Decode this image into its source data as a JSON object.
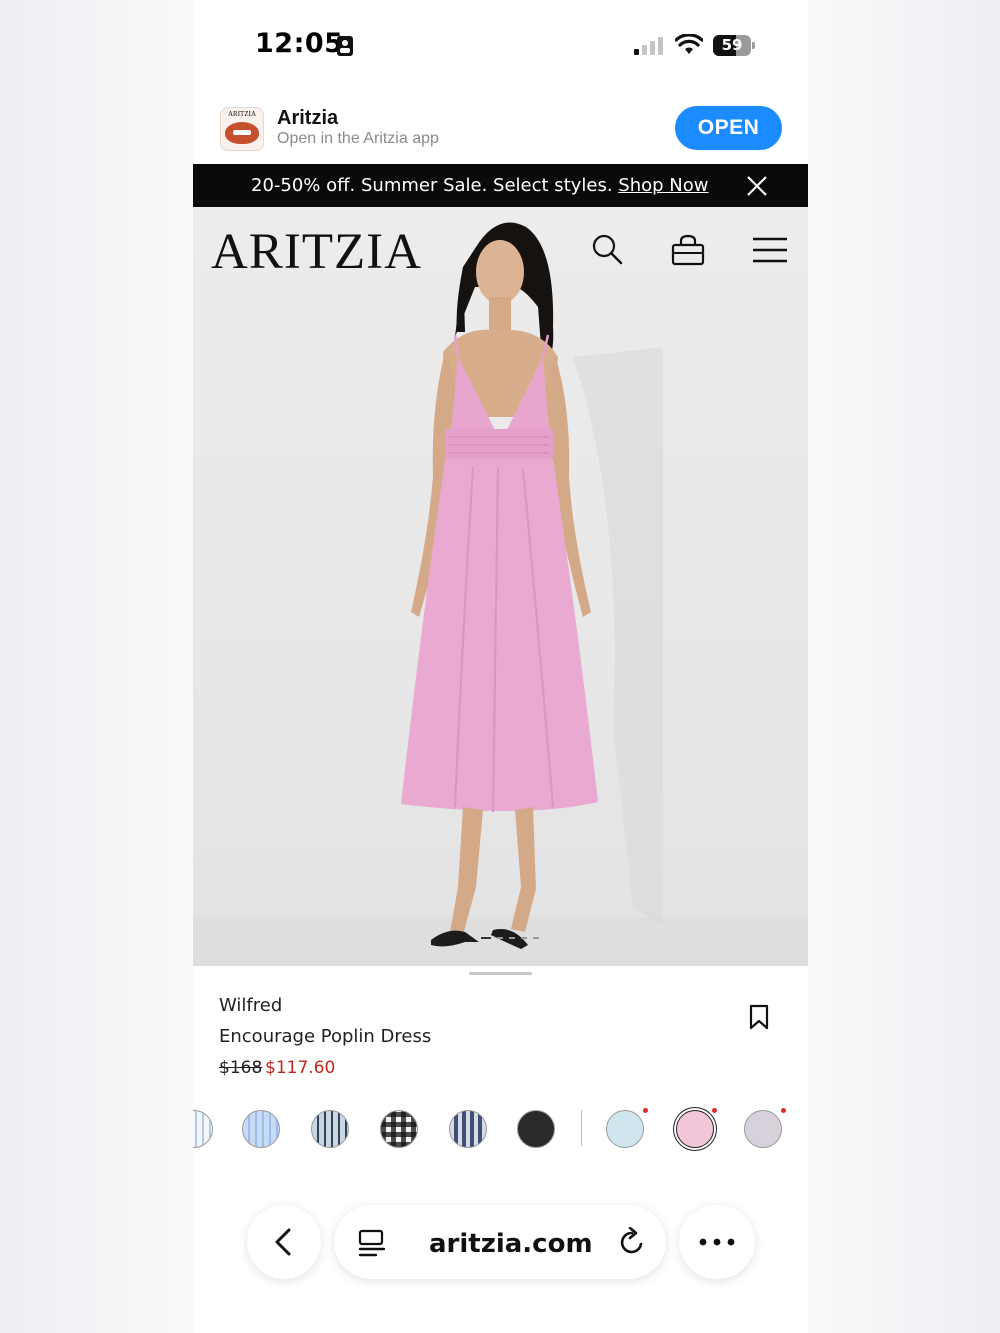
{
  "status_bar": {
    "time": "12:05",
    "battery": "59"
  },
  "app_banner": {
    "app_name": "Aritzia",
    "icon_label": "ARITZIA",
    "subtitle": "Open in the Aritzia app",
    "open_label": "OPEN",
    "accent": "#1a8cff"
  },
  "promo": {
    "text": "20-50% off. Summer Sale. Select styles. ",
    "link": "Shop Now"
  },
  "header": {
    "logo": "ARITZIA",
    "icons": [
      "search-icon",
      "bag-icon",
      "menu-icon"
    ]
  },
  "product": {
    "brand": "Wilfred",
    "name": "Encourage Poplin Dress",
    "original_price": "$168",
    "sale_price": "$117.60",
    "sale_color": "#c0281f",
    "image_dot_count": 5,
    "active_image": 1
  },
  "swatches": [
    {
      "name": "white-blue-stripe",
      "color": "#e4ecf7",
      "pattern": "stripe-light",
      "dot": false
    },
    {
      "name": "light-blue-stripe",
      "color": "#bcd3f2",
      "pattern": "stripe-blue",
      "dot": false
    },
    {
      "name": "blue-grey-stripe",
      "color": "#a7b8c8",
      "pattern": "stripe-dark",
      "dot": false
    },
    {
      "name": "black-gingham",
      "color": "#8a8a8a",
      "pattern": "gingham",
      "dot": false
    },
    {
      "name": "navy-stripe",
      "color": "#6e7f9f",
      "pattern": "stripe-navy",
      "dot": false
    },
    {
      "name": "black",
      "color": "#2a2a2a",
      "pattern": "solid",
      "dot": false
    },
    {
      "name": "light-blue",
      "color": "#cfe6ef",
      "pattern": "solid",
      "dot": true
    },
    {
      "name": "pink",
      "color": "#f4c6da",
      "pattern": "solid",
      "dot": true,
      "selected": true
    },
    {
      "name": "lilac-grey",
      "color": "#d6d1da",
      "pattern": "solid",
      "dot": true
    }
  ],
  "browser": {
    "url": "aritzia.com"
  }
}
